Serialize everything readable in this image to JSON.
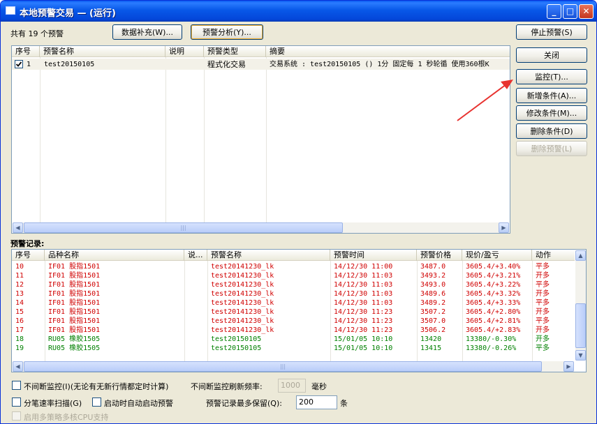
{
  "window": {
    "title": "本地预警交易 — (运行)"
  },
  "top": {
    "count_label": "共有 19 个预警",
    "data_fill_btn": "数据补充(W)...",
    "analysis_btn": "预警分析(Y)...",
    "stop_btn": "停止预警(S)"
  },
  "side_buttons": {
    "close": "关闭",
    "monitor": "监控(T)...",
    "add_cond": "新增条件(A)...",
    "edit_cond": "修改条件(M)...",
    "delete_cond": "删除条件(D)",
    "delete_alert": "删除预警(L)"
  },
  "alerts_table": {
    "columns": [
      "序号",
      "预警名称",
      "说明",
      "预警类型",
      "摘要"
    ],
    "rows": [
      {
        "checked": true,
        "index": "1",
        "name": "test20150105",
        "desc": "",
        "type": "程式化交易",
        "summary": "交易系统 : test20150105 () 1分 固定每 1 秒轮循 使用360根K"
      }
    ]
  },
  "records": {
    "label": "预警记录:",
    "columns": [
      "序号",
      "品种名称",
      "说...",
      "预警名称",
      "预警时间",
      "预警价格",
      "现价/盈亏",
      "动作"
    ],
    "rows": [
      {
        "index": "10",
        "symbol": "IF01 股指1501",
        "desc": "",
        "name": "test20141230_lk",
        "time": "14/12/30 11:00",
        "price": "3487.0",
        "pnl": "3605.4/+3.40%",
        "action": "平多",
        "color": "#d00000"
      },
      {
        "index": "11",
        "symbol": "IF01 股指1501",
        "desc": "",
        "name": "test20141230_lk",
        "time": "14/12/30 11:03",
        "price": "3493.2",
        "pnl": "3605.4/+3.21%",
        "action": "开多",
        "color": "#d00000"
      },
      {
        "index": "12",
        "symbol": "IF01 股指1501",
        "desc": "",
        "name": "test20141230_lk",
        "time": "14/12/30 11:03",
        "price": "3493.0",
        "pnl": "3605.4/+3.22%",
        "action": "平多",
        "color": "#d00000"
      },
      {
        "index": "13",
        "symbol": "IF01 股指1501",
        "desc": "",
        "name": "test20141230_lk",
        "time": "14/12/30 11:03",
        "price": "3489.6",
        "pnl": "3605.4/+3.32%",
        "action": "开多",
        "color": "#d00000"
      },
      {
        "index": "14",
        "symbol": "IF01 股指1501",
        "desc": "",
        "name": "test20141230_lk",
        "time": "14/12/30 11:03",
        "price": "3489.2",
        "pnl": "3605.4/+3.33%",
        "action": "平多",
        "color": "#d00000"
      },
      {
        "index": "15",
        "symbol": "IF01 股指1501",
        "desc": "",
        "name": "test20141230_lk",
        "time": "14/12/30 11:23",
        "price": "3507.2",
        "pnl": "3605.4/+2.80%",
        "action": "开多",
        "color": "#d00000"
      },
      {
        "index": "16",
        "symbol": "IF01 股指1501",
        "desc": "",
        "name": "test20141230_lk",
        "time": "14/12/30 11:23",
        "price": "3507.0",
        "pnl": "3605.4/+2.81%",
        "action": "平多",
        "color": "#d00000"
      },
      {
        "index": "17",
        "symbol": "IF01 股指1501",
        "desc": "",
        "name": "test20141230_lk",
        "time": "14/12/30 11:23",
        "price": "3506.2",
        "pnl": "3605.4/+2.83%",
        "action": "开多",
        "color": "#d00000"
      },
      {
        "index": "18",
        "symbol": "RU05 橡胶1505",
        "desc": "",
        "name": "test20150105",
        "time": "15/01/05 10:10",
        "price": "13420",
        "pnl": "13380/-0.30%",
        "action": "开多",
        "color": "#008000"
      },
      {
        "index": "19",
        "symbol": "RU05 橡胶1505",
        "desc": "",
        "name": "test20150105",
        "time": "15/01/05 10:10",
        "price": "13415",
        "pnl": "13380/-0.26%",
        "action": "平多",
        "color": "#008000"
      }
    ]
  },
  "options": {
    "continuous_monitor": "不间断监控(I)(无论有无新行情都定时计算)",
    "refresh_rate_label": "不间断监控刷新频率:",
    "refresh_rate_value": "1000",
    "ms_unit": "毫秒",
    "tick_scan": "分笔速率扫描(G)",
    "auto_start": "启动时自动启动预警",
    "keep_label": "预警记录最多保留(Q):",
    "keep_value": "200",
    "keep_unit": "条",
    "multicore": "启用多策略多核CPU支持"
  },
  "colors": {
    "titlebar": "#0858e8",
    "loss_up": "#d00000",
    "profit_green": "#008000",
    "annotation_arrow": "#e8322f"
  }
}
